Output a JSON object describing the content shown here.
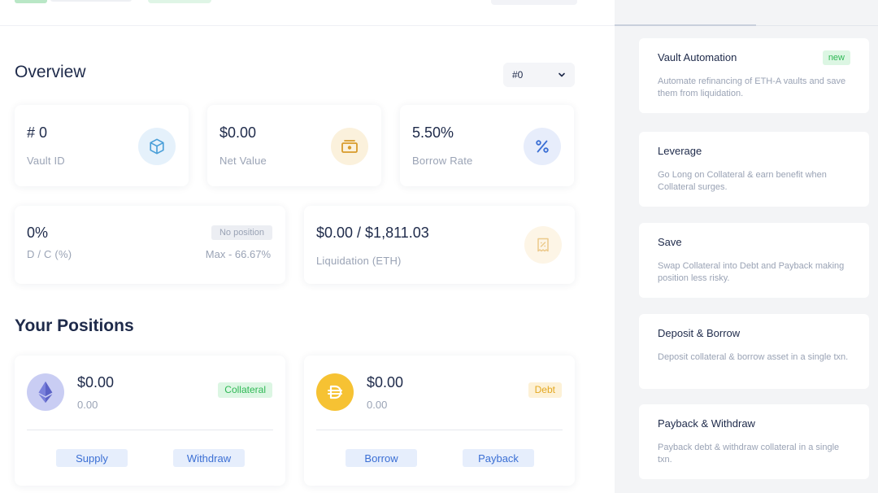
{
  "overview": {
    "title": "Overview",
    "vault_select": {
      "value": "#0",
      "icon": "chevron-down-icon"
    }
  },
  "stats": {
    "vault_id": {
      "value": "# 0",
      "label": "Vault ID",
      "icon": "cube-icon"
    },
    "net_value": {
      "value": "$0.00",
      "label": "Net Value",
      "icon": "cash-icon"
    },
    "borrow_rate": {
      "value": "5.50%",
      "label": "Borrow Rate",
      "icon": "percent-icon"
    },
    "debt_collateral": {
      "value": "0%",
      "label": "D / C (%)",
      "badge": "No position",
      "max": "Max - 66.67%"
    },
    "liquidation": {
      "value": "$0.00 / $1,811.03",
      "label": "Liquidation (ETH)",
      "icon": "receipt-icon"
    }
  },
  "positions": {
    "title": "Your Positions",
    "collateral": {
      "amount": "$0.00",
      "sub": "0.00",
      "badge": "Collateral",
      "icon": "eth-icon",
      "actions": [
        "Supply",
        "Withdraw"
      ]
    },
    "debt": {
      "amount": "$0.00",
      "sub": "0.00",
      "badge": "Debt",
      "icon": "dai-icon",
      "actions": [
        "Borrow",
        "Payback"
      ]
    }
  },
  "strategies": [
    {
      "title": "Vault Automation",
      "desc": "Automate refinancing of ETH-A vaults and save them from liquidation.",
      "badge": "new"
    },
    {
      "title": "Leverage",
      "desc": "Go Long on Collateral & earn benefit when Collateral surges."
    },
    {
      "title": "Save",
      "desc": "Swap Collateral into Debt and Payback making position less risky."
    },
    {
      "title": "Deposit & Borrow",
      "desc": "Deposit collateral & borrow asset in a single txn."
    },
    {
      "title": "Payback & Withdraw",
      "desc": "Payback debt & withdraw collateral in a single txn."
    }
  ],
  "colors": {
    "accent_blue": "#3b6fd4",
    "green_badge": "#2fb855",
    "debt_badge": "#e3a822",
    "muted_text": "#9aa3b5",
    "dark_text": "#1e2a4a"
  }
}
